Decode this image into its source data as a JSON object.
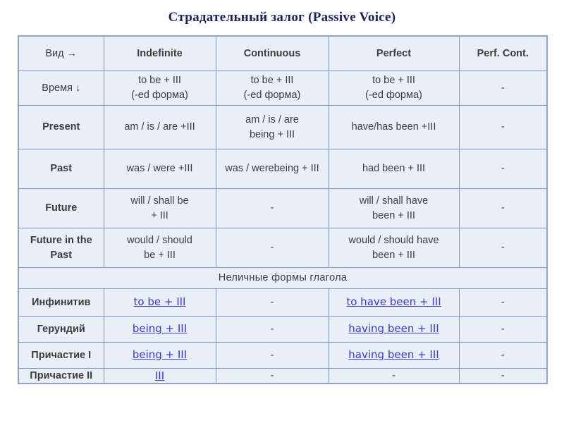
{
  "title": "Страдательный залог (Passive Voice)",
  "colors": {
    "title": "#1b1f5e",
    "border": "#7f97c2",
    "cell_bg": "#eaeef7",
    "link": "#3a3ad0"
  },
  "header": {
    "corner": "Вид →",
    "columns": [
      "Indefinite",
      "Continuous",
      "Perfect",
      "Perf. Cont."
    ]
  },
  "time_row": {
    "label": "Время ↓",
    "cells": [
      [
        "to be  +  III",
        "(-ed форма)"
      ],
      [
        "to be  +  III",
        "(-ed форма)"
      ],
      [
        "to be  +  III",
        "(-ed форма)"
      ],
      [
        "-"
      ]
    ]
  },
  "tense_rows": [
    {
      "label": [
        "Present"
      ],
      "cells": [
        [
          "am / is / are +III"
        ],
        [
          "am / is / are",
          "being + III"
        ],
        [
          "have/has  been +III"
        ],
        [
          "-"
        ]
      ]
    },
    {
      "label": [
        "Past"
      ],
      "cells": [
        [
          "was / were +III"
        ],
        [
          "was / werebeing + III"
        ],
        [
          "had been + III"
        ],
        [
          "-"
        ]
      ]
    },
    {
      "label": [
        "Future"
      ],
      "cells": [
        [
          "will / shall  be",
          "+ III"
        ],
        [
          "-"
        ],
        [
          "will / shall  have",
          "been + III"
        ],
        [
          "-"
        ]
      ]
    },
    {
      "label": [
        "Future in the",
        "Past"
      ],
      "cells": [
        [
          "would / should",
          "be + III"
        ],
        [
          "-"
        ],
        [
          "would / should have",
          "been + III"
        ],
        [
          "-"
        ]
      ]
    }
  ],
  "section_label": "Неличные  формы  глагола",
  "nonfinite_rows": [
    {
      "label": "Инфинитив",
      "cells": [
        "to be + III",
        "-",
        "to have been + III",
        "-"
      ]
    },
    {
      "label": "Герундий",
      "cells": [
        "being + III",
        "-",
        "having been + III",
        "-"
      ]
    },
    {
      "label": "Причастие I",
      "cells": [
        "being + III",
        "-",
        "having been + III",
        "-"
      ]
    },
    {
      "label": "Причастие II",
      "cells": [
        "III",
        "-",
        "-",
        "-"
      ]
    }
  ]
}
